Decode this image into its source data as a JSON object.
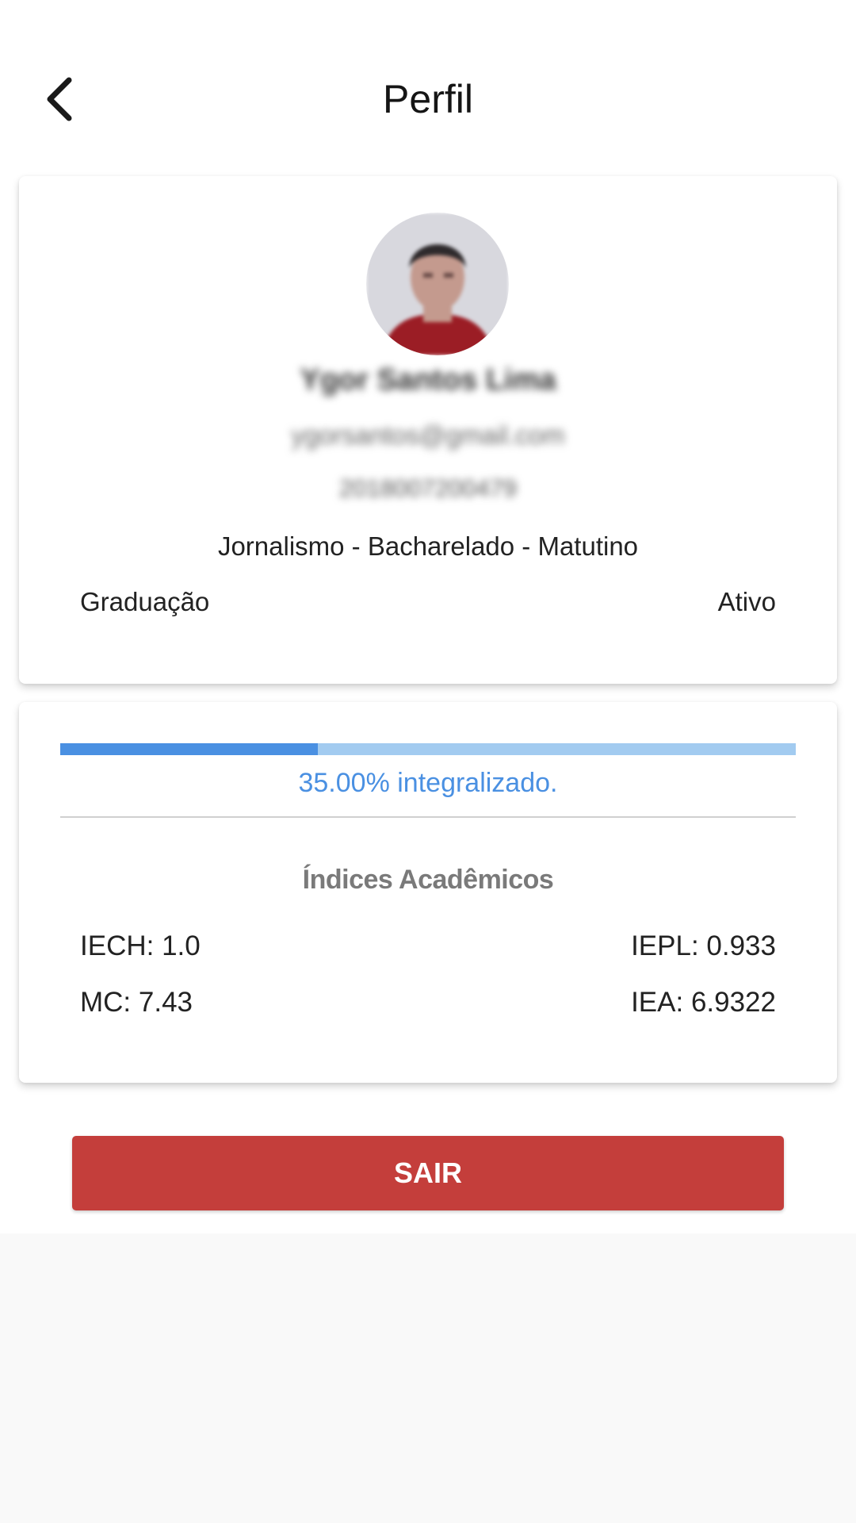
{
  "header": {
    "title": "Perfil",
    "back_icon": "chevron-left-icon"
  },
  "profile": {
    "avatar_icon": "user-photo",
    "name": "Ygor Santos Lima",
    "email": "ygorsantos@gmail.com",
    "registration": "2018007200479",
    "course": "Jornalismo - Bacharelado - Matutino",
    "level": "Graduação",
    "status": "Ativo"
  },
  "progress": {
    "percent": 35,
    "label": "35.00% integralizado.",
    "fill_color": "#4a90e2",
    "track_color": "#a2cbf0"
  },
  "indices": {
    "title": "Índices Acadêmicos",
    "iech": "IECH: 1.0",
    "iepl": "IEPL: 0.933",
    "mc": "MC: 7.43",
    "iea": "IEA: 6.9322"
  },
  "actions": {
    "logout_label": "SAIR",
    "logout_color": "#c43e3b"
  }
}
